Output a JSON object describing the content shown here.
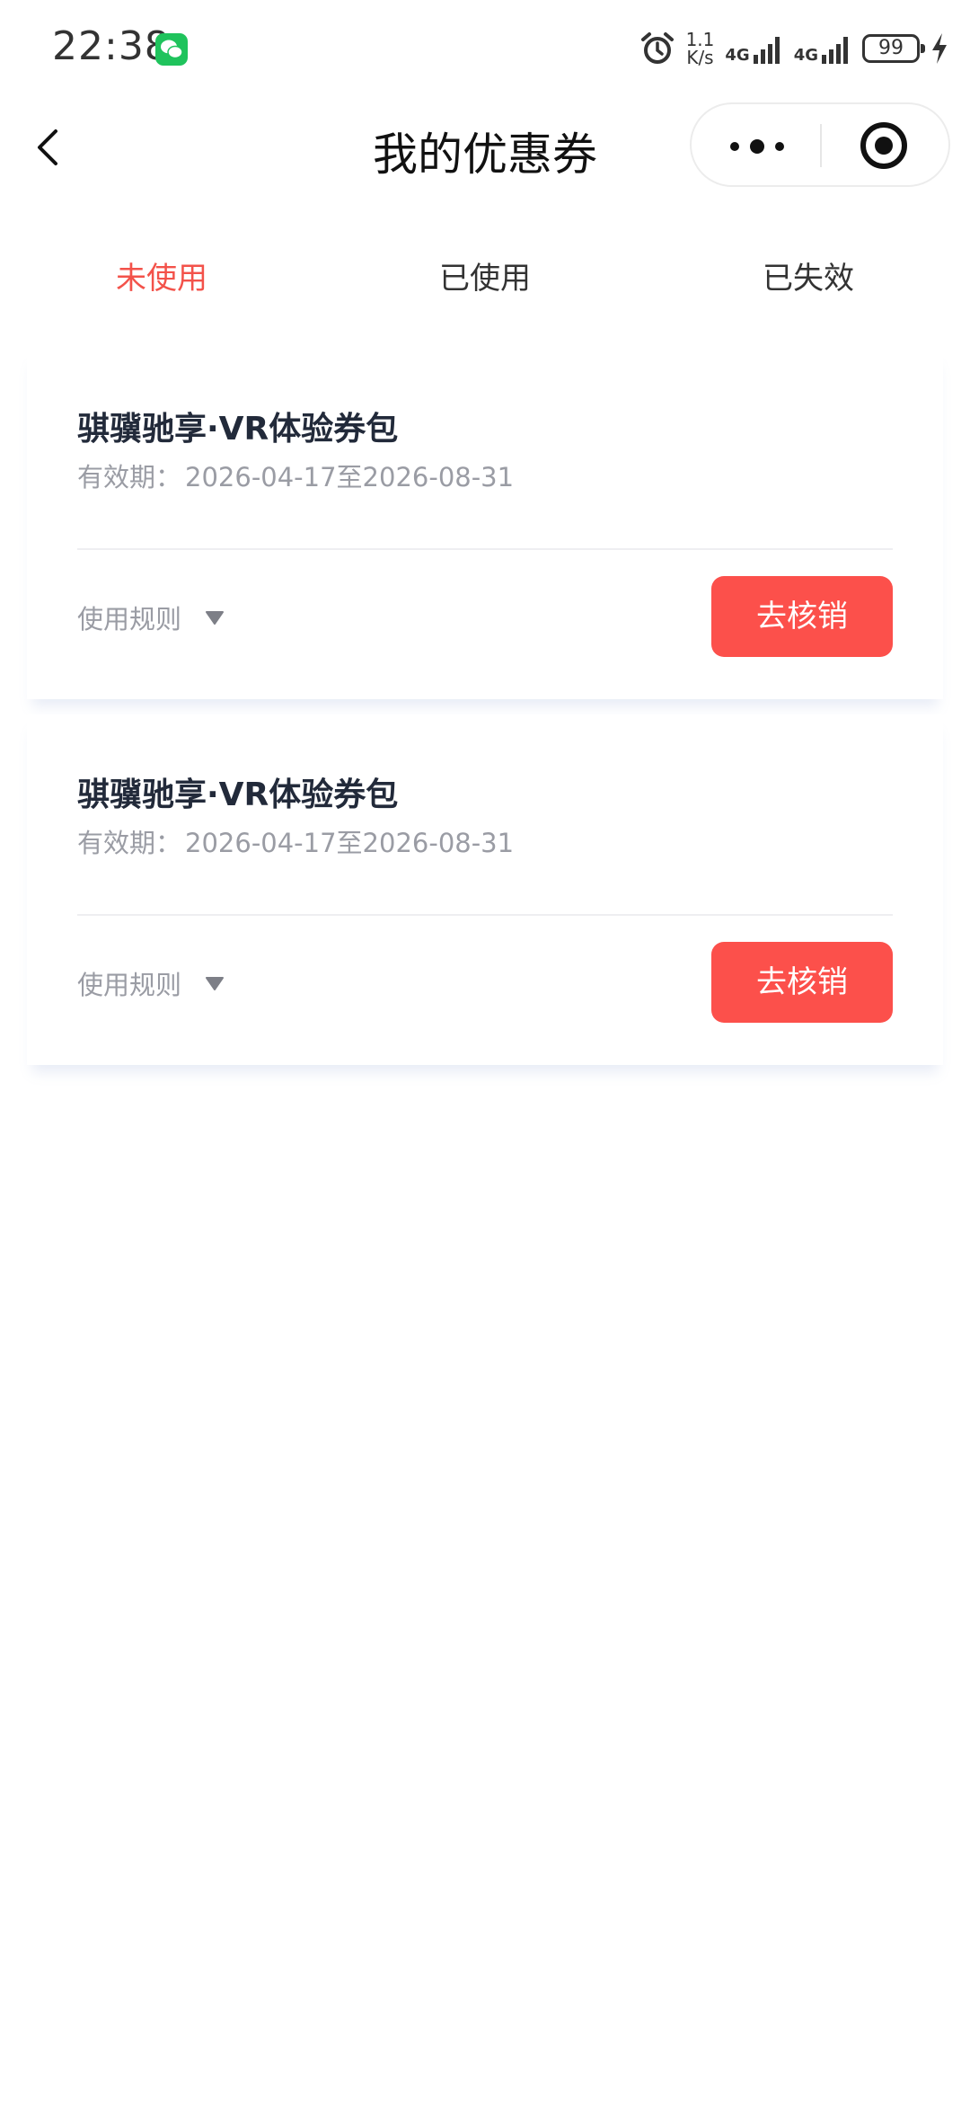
{
  "status_bar": {
    "time": "22:38",
    "speed_top": "1.1",
    "speed_bottom": "K/s",
    "net1": "4G",
    "net2": "4G",
    "battery": "99"
  },
  "navbar": {
    "title": "我的优惠券"
  },
  "tabs": [
    {
      "label": "未使用",
      "active": true
    },
    {
      "label": "已使用",
      "active": false
    },
    {
      "label": "已失效",
      "active": false
    }
  ],
  "coupons": [
    {
      "title": "骐骥驰享·VR体验券包",
      "validity_label": "有效期：",
      "validity": "2026-04-17至2026-08-31",
      "rules_label": "使用规则",
      "button_label": "去核销"
    },
    {
      "title": "骐骥驰享·VR体验券包",
      "validity_label": "有效期：",
      "validity": "2026-04-17至2026-08-31",
      "rules_label": "使用规则",
      "button_label": "去核销"
    }
  ],
  "colors": {
    "accent": "#f3524a",
    "button": "#fc504b",
    "wechat_green": "#1fc35c"
  }
}
